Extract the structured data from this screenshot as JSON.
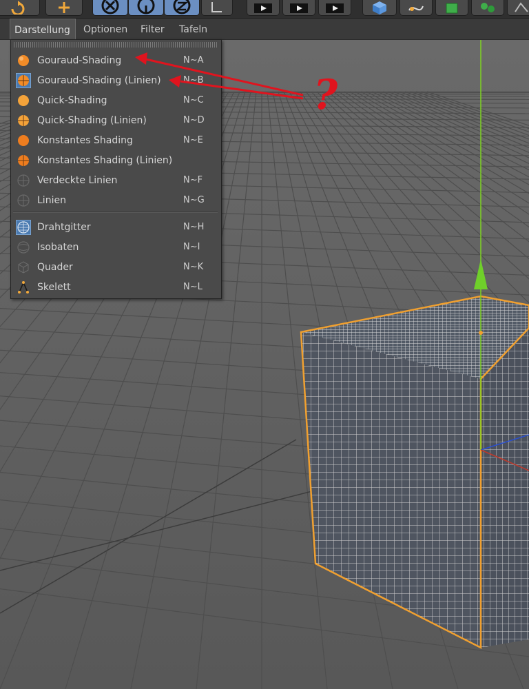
{
  "menubar": {
    "items": [
      {
        "label": "Darstellung"
      },
      {
        "label": "Optionen"
      },
      {
        "label": "Filter"
      },
      {
        "label": "Tafeln"
      }
    ]
  },
  "dropdown": {
    "items": [
      {
        "label": "Gouraud-Shading",
        "shortcut": "N~A",
        "icon": "sphere-shaded-icon"
      },
      {
        "label": "Gouraud-Shading (Linien)",
        "shortcut": "N~B",
        "icon": "sphere-lines-icon",
        "highlighted": true
      },
      {
        "label": "Quick-Shading",
        "shortcut": "N~C",
        "icon": "sphere-quick-icon"
      },
      {
        "label": "Quick-Shading (Linien)",
        "shortcut": "N~D",
        "icon": "sphere-quick-lines-icon"
      },
      {
        "label": "Konstantes Shading",
        "shortcut": "N~E",
        "icon": "sphere-constant-icon"
      },
      {
        "label": "Konstantes Shading (Linien)",
        "shortcut": "",
        "icon": "sphere-constant-lines-icon"
      },
      {
        "label": "Verdeckte Linien",
        "shortcut": "N~F",
        "icon": "hidden-lines-icon"
      },
      {
        "label": "Linien",
        "shortcut": "N~G",
        "icon": "lines-icon"
      },
      {
        "label": "Drahtgitter",
        "shortcut": "N~H",
        "icon": "wireframe-icon"
      },
      {
        "label": "Isobaten",
        "shortcut": "N~I",
        "icon": "isoparms-icon"
      },
      {
        "label": "Quader",
        "shortcut": "N~K",
        "icon": "box-icon"
      },
      {
        "label": "Skelett",
        "shortcut": "N~L",
        "icon": "skeleton-icon"
      }
    ]
  },
  "annotation": {
    "text": "?",
    "color": "#e0141e"
  },
  "colors": {
    "orange": "#f28c28",
    "selection": "#f0a030",
    "axis_green": "#7ed321",
    "menu_bg": "#4a4a4a"
  }
}
